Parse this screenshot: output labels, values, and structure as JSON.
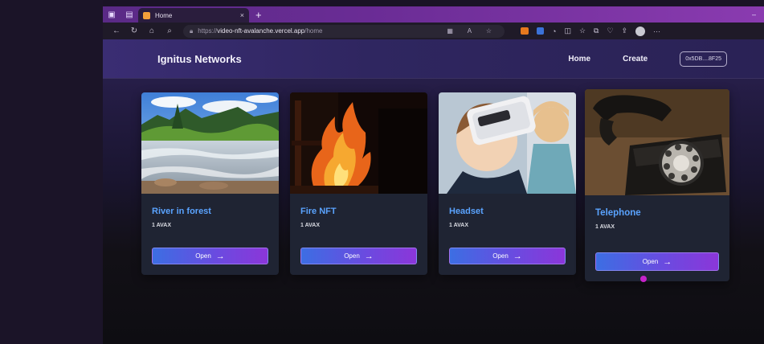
{
  "browser": {
    "tab_title": "Home",
    "url_prefix": "https://",
    "url_host": "video-nft-avalanche.vercel.app",
    "url_path": "/home",
    "new_tab": "+",
    "tab_close": "×",
    "window_min": "–"
  },
  "header": {
    "brand": "Ignitus Networks",
    "nav": [
      {
        "label": "Home"
      },
      {
        "label": "Create"
      }
    ],
    "wallet": "0x5DB....8F25"
  },
  "cards": [
    {
      "title": "River in forest",
      "price": "1 AVAX",
      "button": "Open",
      "icon": "river-image"
    },
    {
      "title": "Fire NFT",
      "price": "1 AVAX",
      "button": "Open",
      "icon": "fire-image"
    },
    {
      "title": "Headset",
      "price": "1 AVAX",
      "button": "Open",
      "icon": "vr-headset-image"
    },
    {
      "title": "Telephone",
      "price": "1 AVAX",
      "button": "Open",
      "icon": "telephone-image"
    }
  ],
  "colors": {
    "accent": "#5aa3ff",
    "button_start": "#3c6ee3",
    "button_end": "#8b36d9"
  }
}
